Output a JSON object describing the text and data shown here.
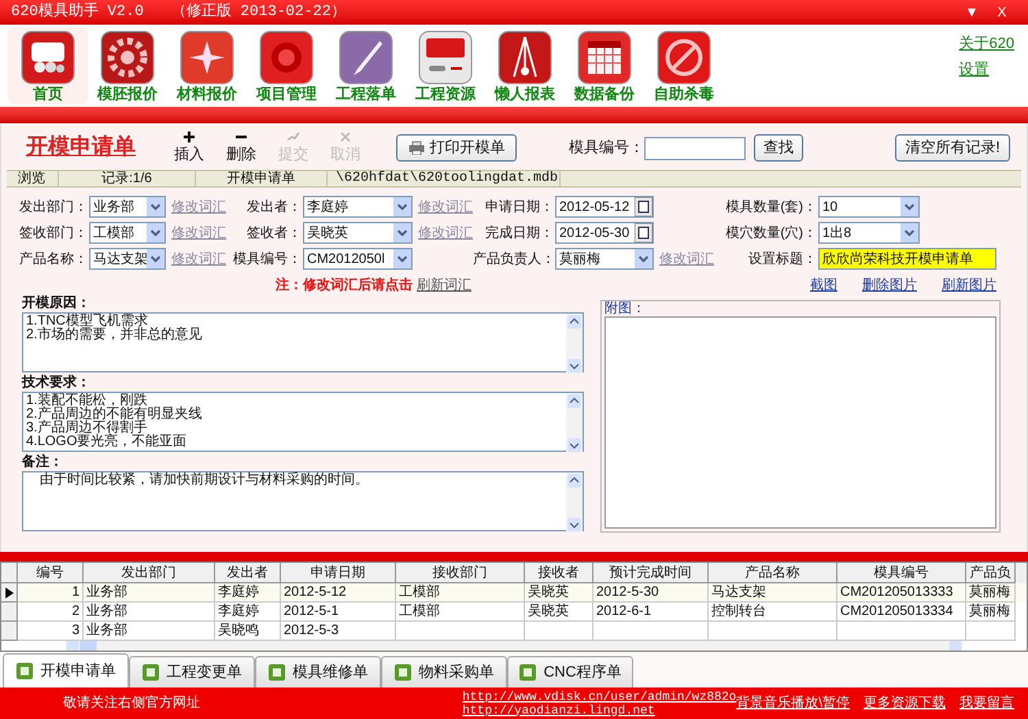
{
  "window": {
    "title": "620模具助手 V2.0",
    "edition": "（修正版 2013-02-22）",
    "controls": [
      "▼",
      "X"
    ]
  },
  "toolbar": [
    {
      "label": "首页",
      "selected": true
    },
    {
      "label": "模胚报价",
      "selected": false
    },
    {
      "label": "材料报价",
      "selected": false
    },
    {
      "label": "项目管理",
      "selected": false
    },
    {
      "label": "工程落单",
      "selected": false
    },
    {
      "label": "工程资源",
      "selected": false
    },
    {
      "label": "懒人报表",
      "selected": false
    },
    {
      "label": "数据备份",
      "selected": false
    },
    {
      "label": "自助杀毒",
      "selected": false
    }
  ],
  "top_links": [
    "关于620",
    "设置"
  ],
  "form": {
    "title": "开模申请单",
    "actions": [
      {
        "label": "插入",
        "kind": "plus",
        "disabled": false
      },
      {
        "label": "删除",
        "kind": "minus",
        "disabled": false
      },
      {
        "label": "提交",
        "kind": "check",
        "disabled": true
      },
      {
        "label": "取消",
        "kind": "cross",
        "disabled": true
      }
    ],
    "print_button": "打印开模单",
    "search": {
      "label": "模具编号：",
      "button": "查找"
    },
    "clear_button": "清空所有记录!",
    "record_bar": [
      "浏览",
      "记录:1/6",
      "开模申请单",
      "\\620hfdat\\620toolingdat.mdb"
    ],
    "field_rows": [
      [
        {
          "label": "发出部门：",
          "value": "业务部",
          "kind": "select",
          "link": "修改词汇"
        },
        {
          "label": "发出者：",
          "value": "李庭婷",
          "kind": "select",
          "link": "修改词汇"
        },
        {
          "label": "申请日期：",
          "value": "2012-05-12",
          "kind": "date"
        },
        {
          "label": "模具数量(套)：",
          "value": "10",
          "kind": "select"
        }
      ],
      [
        {
          "label": "签收部门：",
          "value": "工模部",
          "kind": "select",
          "link": "修改词汇"
        },
        {
          "label": "签收者：",
          "value": "吴晓英",
          "kind": "select",
          "link": "修改词汇"
        },
        {
          "label": "完成日期：",
          "value": "2012-05-30",
          "kind": "date"
        },
        {
          "label": "模穴数量(穴)：",
          "value": "1出8",
          "kind": "select"
        }
      ],
      [
        {
          "label": "产品名称：",
          "value": "马达支架",
          "kind": "select",
          "link": "修改词汇"
        },
        {
          "label": "模具编号：",
          "value": "CM2012050l",
          "kind": "select"
        },
        {
          "label": "产品负责人：",
          "value": "莫丽梅",
          "kind": "select",
          "link": "修改词汇"
        },
        {
          "label": "设置标题：",
          "value": "欣欣尚荣科技开模申请单",
          "kind": "text"
        }
      ]
    ],
    "note": "注：修改词汇后请点击",
    "note_link": "刷新词汇",
    "picture_links": [
      "截图",
      "删除图片",
      "刷新图片"
    ],
    "text_areas": [
      {
        "label": "开模原因：",
        "lines": [
          "1.TNC模型飞机需求",
          "2.市场的需要，并非总的意见"
        ]
      },
      {
        "label": "技术要求：",
        "lines": [
          "1.装配不能松，刚跌",
          "2.产品周边的不能有明显夹线",
          "3.产品周边不得割手",
          "4.LOGO要光亮，不能亚面"
        ]
      },
      {
        "label": "备注：",
        "lines": [
          "　由于时间比较紧，请加快前期设计与材料采购的时间。"
        ]
      }
    ],
    "attachment": {
      "label": "附图："
    }
  },
  "table": {
    "columns": [
      "编号",
      "发出部门",
      "发出者",
      "申请日期",
      "接收部门",
      "接收者",
      "预计完成时间",
      "产品名称",
      "模具编号",
      "产品负"
    ],
    "rows": [
      {
        "selected": true,
        "cells": [
          "1",
          "业务部",
          "李庭婷",
          "2012-5-12",
          "工模部",
          "吴晓英",
          "2012-5-30",
          "马达支架",
          "CM201205013333",
          "莫丽梅"
        ]
      },
      {
        "selected": false,
        "cells": [
          "2",
          "业务部",
          "李庭婷",
          "2012-5-1",
          "工模部",
          "吴晓英",
          "2012-6-1",
          "控制转台",
          "CM201205013334",
          "莫丽梅"
        ]
      },
      {
        "selected": false,
        "cells": [
          "3",
          "业务部",
          "吴晓鸣",
          "2012-5-3",
          "",
          "",
          "",
          "",
          "",
          ""
        ]
      }
    ]
  },
  "bottom_tabs": [
    {
      "label": "开模申请单",
      "selected": true
    },
    {
      "label": "工程变更单",
      "selected": false
    },
    {
      "label": "模具维修单",
      "selected": false
    },
    {
      "label": "物料采购单",
      "selected": false
    },
    {
      "label": "CNC程序单",
      "selected": false
    }
  ],
  "footer": {
    "notice": "敬请关注右侧官方网址",
    "urls": [
      "http://www.vdisk.cn/user/admin/wz882o",
      "http://yaodianzi.lingd.net"
    ],
    "links": [
      "背景音乐播放\\暂停",
      "更多资源下载",
      "我要留言"
    ]
  }
}
